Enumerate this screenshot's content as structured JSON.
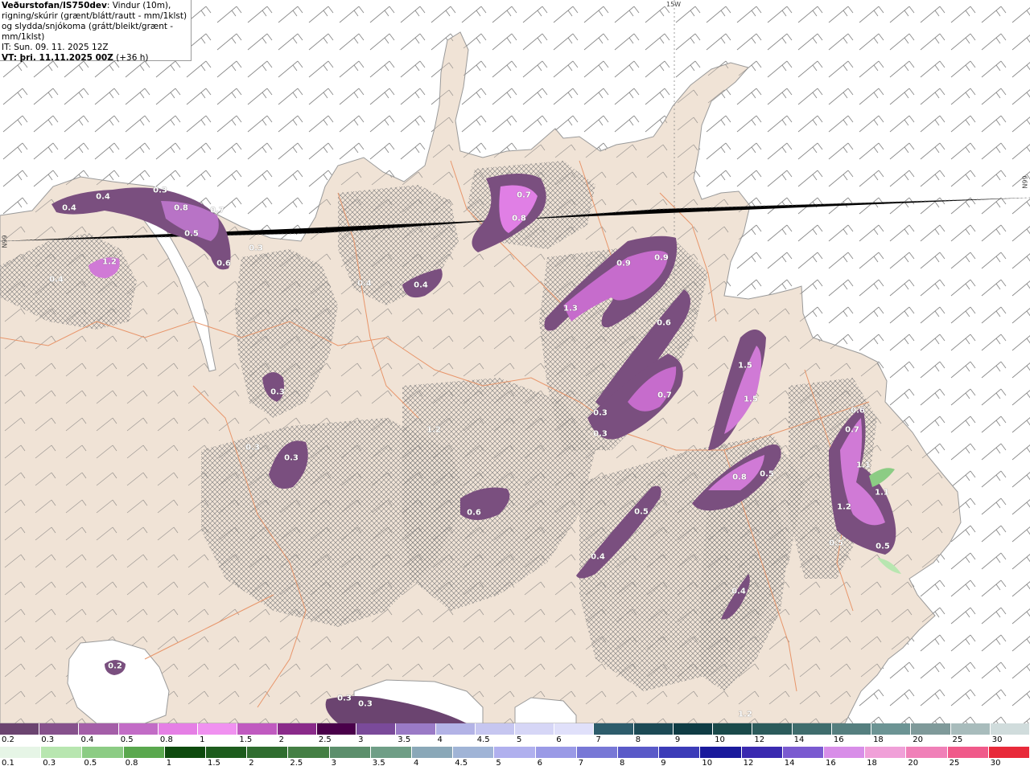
{
  "header": {
    "title": "Veðurstofan/IS750dev",
    "description": ": Vindur (10m), rigning/skúrir (grænt/blátt/rautt - mm/1klst) og slydda/snjókoma (grátt/bleikt/grænt - mm/1klst)",
    "initial_time": "IT: Sun. 09. 11. 2025 12Z",
    "valid_prefix": "VT: þri. 11.11.2025 00Z",
    "valid_suffix": " (+36 h)"
  },
  "grid_labels": {
    "lon_top": "15W",
    "lat_left": "N99",
    "lat_right": "N99"
  },
  "precip_values": [
    "0.4",
    "0.4",
    "0.3",
    "0.8",
    "0.7",
    "0.5",
    "0.6",
    "0.3",
    "1.2",
    "0.4",
    "0.7",
    "0.8",
    "0.4",
    "0.4",
    "0.9",
    "0.9",
    "1.3",
    "0.6",
    "0.3",
    "0.7",
    "0.3",
    "0.3",
    "1.2",
    "0.3",
    "0.3",
    "1.5",
    "1.5",
    "0.6",
    "0.7",
    "1.1",
    "1.1",
    "1.2",
    "0.5",
    "0.5",
    "0.6",
    "0.5",
    "0.4",
    "0.4",
    "0.8",
    "0.5",
    "0.2",
    "0.3",
    "0.3",
    "1.2"
  ],
  "legend_snow": {
    "labels": [
      "0.2",
      "0.3",
      "0.4",
      "0.5",
      "0.8",
      "1",
      "1.5",
      "2",
      "2.5",
      "3",
      "3.5",
      "4",
      "4.5",
      "5",
      "6",
      "7",
      "8",
      "9",
      "10",
      "12",
      "14",
      "16",
      "18",
      "20",
      "25",
      "30"
    ],
    "colors": [
      "#6b4470",
      "#86518c",
      "#a45ea8",
      "#c26cc6",
      "#e57fe5",
      "#f091f0",
      "#c05ac0",
      "#8a2a8a",
      "#4a004a",
      "#7a4a9a",
      "#9a7ac6",
      "#b3b3e6",
      "#c6c6f0",
      "#d6d6f6",
      "#e0e0fa",
      "#2d5c6b",
      "#1c4a55",
      "#0f3c44",
      "#1a4a4a",
      "#2b5b5b",
      "#3f6d6d",
      "#557f7f",
      "#6c9494",
      "#7f9a9a",
      "#a8bcbc",
      "#d0dcdc"
    ]
  },
  "legend_rain": {
    "labels": [
      "0.1",
      "0.3",
      "0.5",
      "0.8",
      "1",
      "1.5",
      "2",
      "2.5",
      "3",
      "3.5",
      "4",
      "4.5",
      "5",
      "6",
      "7",
      "8",
      "9",
      "10",
      "12",
      "14",
      "16",
      "18",
      "20",
      "25",
      "30"
    ],
    "colors": [
      "#e6f5e6",
      "#b8e6b0",
      "#8ccc84",
      "#5aa84e",
      "#0e4a0e",
      "#1d5c1d",
      "#2f6d2f",
      "#447f44",
      "#5c8f6c",
      "#6f9e86",
      "#8aa8b8",
      "#a0b4d6",
      "#b0b0ee",
      "#9a9ae6",
      "#7878d6",
      "#5a5ac8",
      "#3c3cb8",
      "#1a1a9c",
      "#3a2ab0",
      "#7a5ad0",
      "#d88ee8",
      "#f0a0d8",
      "#f080b8",
      "#f05a8a",
      "#e82a3a"
    ]
  }
}
